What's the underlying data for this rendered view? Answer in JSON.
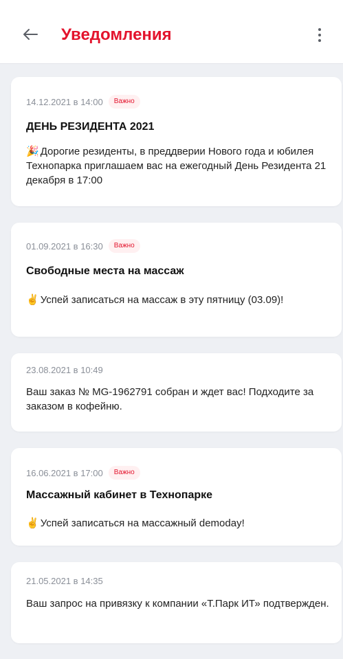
{
  "header": {
    "title": "Уведомления",
    "back_icon": "arrow-left-icon",
    "menu_icon": "more-vertical-icon"
  },
  "colors": {
    "accent": "#e3142d",
    "badge_bg": "#fff0f1",
    "page_bg": "#eef0f4"
  },
  "notifications": [
    {
      "date": "14.12.2021 в 14:00",
      "badge": "Важно",
      "title": "ДЕНЬ РЕЗИДЕНТА 2021",
      "emoji": "🎉",
      "body": "Дорогие резиденты, в преддверии Нового года и юбилея Технопарка приглашаем вас на ежегодный День Резидента 21 декабря в 17:00"
    },
    {
      "date": "01.09.2021 в 16:30",
      "badge": "Важно",
      "title": "Свободные места на массаж",
      "emoji": "✌️",
      "body": "Успей записаться на массаж в эту пятницу (03.09)!"
    },
    {
      "date": "23.08.2021 в 10:49",
      "body": "Ваш заказ № MG-1962791 собран и ждет вас! Подходите за заказом в кофейню."
    },
    {
      "date": "16.06.2021 в 17:00",
      "badge": "Важно",
      "title": "Массажный кабинет в Технопарке",
      "emoji": "✌️",
      "body": "Успей записаться на массажный demoday!"
    },
    {
      "date": "21.05.2021 в 14:35",
      "body": "Ваш запрос на привязку к компании «Т.Парк ИТ» подтвержден."
    }
  ]
}
